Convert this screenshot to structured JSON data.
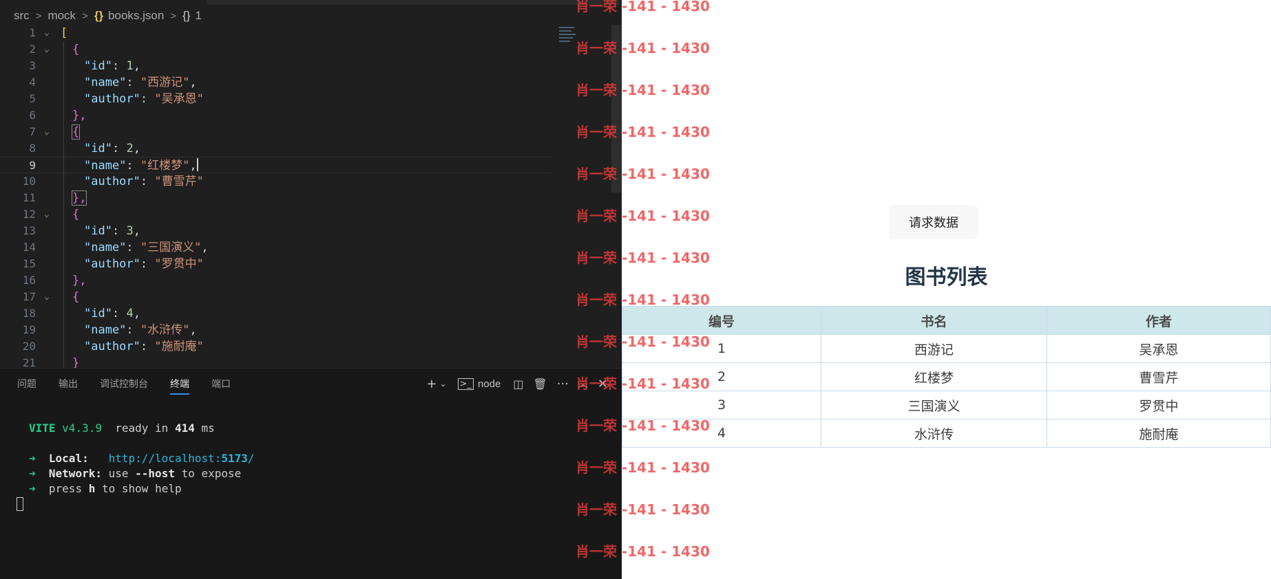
{
  "breadcrumb": {
    "items": [
      "src",
      "mock",
      "books.json",
      "1"
    ],
    "json_icon": "{}",
    "object_icon": "{}"
  },
  "editor": {
    "lines": [
      {
        "n": "1"
      },
      {
        "n": "2"
      },
      {
        "n": "3"
      },
      {
        "n": "4"
      },
      {
        "n": "5"
      },
      {
        "n": "6"
      },
      {
        "n": "7"
      },
      {
        "n": "8"
      },
      {
        "n": "9"
      },
      {
        "n": "10"
      },
      {
        "n": "11"
      },
      {
        "n": "12"
      },
      {
        "n": "13"
      },
      {
        "n": "14"
      },
      {
        "n": "15"
      },
      {
        "n": "16"
      },
      {
        "n": "17"
      },
      {
        "n": "18"
      },
      {
        "n": "19"
      },
      {
        "n": "20"
      },
      {
        "n": "21"
      }
    ],
    "current_line": "9",
    "tokens": {
      "open_bracket": "[",
      "open_brace": "{",
      "close_brace": "},",
      "close_last": "}",
      "comma": ",",
      "colon": ": ",
      "key_id": "\"id\"",
      "key_name": "\"name\"",
      "key_author": "\"author\""
    },
    "books": [
      {
        "id": "1",
        "name": "\"西游记\"",
        "author": "\"吴承恩\""
      },
      {
        "id": "2",
        "name": "\"红楼梦\"",
        "author": "\"曹雪芹\""
      },
      {
        "id": "3",
        "name": "\"三国演义\"",
        "author": "\"罗贯中\""
      },
      {
        "id": "4",
        "name": "\"水浒传\"",
        "author": "\"施耐庵\""
      }
    ]
  },
  "panel": {
    "tabs": [
      "问题",
      "输出",
      "调试控制台",
      "终端",
      "端口"
    ],
    "active_tab": "终端",
    "terminal_label": "node",
    "terminal": {
      "vite": "VITE",
      "version": "v4.3.9",
      "ready": "ready in",
      "ms_value": "414",
      "ms_unit": "ms",
      "arrow": "➜",
      "local_label": "Local:",
      "local_url_prefix": "http://localhost:",
      "local_url_port": "5173",
      "local_url_suffix": "/",
      "network_label": "Network:",
      "network_use": "use",
      "network_flag": "--host",
      "network_rest": "to expose",
      "help_prefix": "press",
      "help_key": "h",
      "help_rest": "to show help"
    }
  },
  "preview": {
    "button_label": "请求数据",
    "list_title": "图书列表",
    "table": {
      "headers": [
        "编号",
        "书名",
        "作者"
      ],
      "rows": [
        [
          "1",
          "西游记",
          "吴承恩"
        ],
        [
          "2",
          "红楼梦",
          "曹雪芹"
        ],
        [
          "3",
          "三国演义",
          "罗贯中"
        ],
        [
          "4",
          "水浒传",
          "施耐庵"
        ]
      ]
    }
  },
  "watermark": {
    "text": "肖一荣 -141 - 1430",
    "count": 14,
    "color": "#ec3c3c"
  },
  "colors": {
    "editor_bg": "#1f1f1f",
    "panel_bg": "#181818",
    "json_key": "#9cdcfe",
    "json_string": "#ce9178",
    "json_number": "#b5cea8",
    "terminal_green": "#23d18b",
    "terminal_url": "#29b8db",
    "table_header_bg": "#cde7ea",
    "title_color": "#213547"
  },
  "icons": {
    "fold": "chevron-down-icon",
    "add_terminal": "plus-icon",
    "terminal_dropdown": "chevron-down-icon",
    "terminal_shell": "terminal-icon",
    "split": "split-icon",
    "kill": "trash-icon",
    "more": "ellipsis-icon",
    "maximize": "chevron-up-icon",
    "close": "close-icon"
  }
}
